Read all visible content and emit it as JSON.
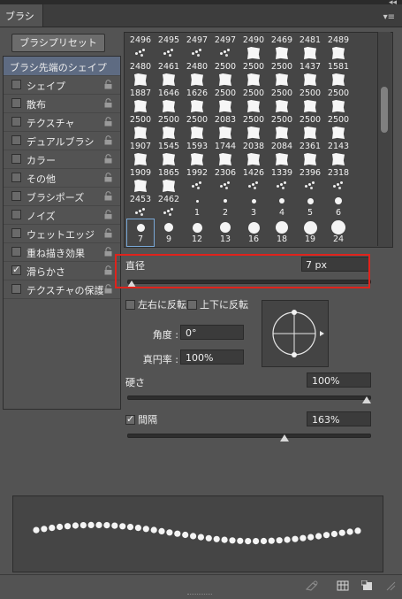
{
  "panel": {
    "tab": "ブラシ",
    "preset_button": "ブラシプリセット"
  },
  "options": [
    {
      "label": "ブラシ先端のシェイプ",
      "checkbox": false,
      "checked": false,
      "lock": false,
      "header": true
    },
    {
      "label": "シェイプ",
      "checkbox": true,
      "checked": false,
      "lock": true
    },
    {
      "label": "散布",
      "checkbox": true,
      "checked": false,
      "lock": true
    },
    {
      "label": "テクスチャ",
      "checkbox": true,
      "checked": false,
      "lock": true
    },
    {
      "label": "デュアルブラシ",
      "checkbox": true,
      "checked": false,
      "lock": true
    },
    {
      "label": "カラー",
      "checkbox": true,
      "checked": false,
      "lock": true
    },
    {
      "label": "その他",
      "checkbox": true,
      "checked": false,
      "lock": true
    },
    {
      "label": "ブラシポーズ",
      "checkbox": true,
      "checked": false,
      "lock": true
    },
    {
      "label": "ノイズ",
      "checkbox": true,
      "checked": false,
      "lock": true
    },
    {
      "label": "ウェットエッジ",
      "checkbox": true,
      "checked": false,
      "lock": true
    },
    {
      "label": "重ね描き効果",
      "checkbox": true,
      "checked": false,
      "lock": true
    },
    {
      "label": "滑らかさ",
      "checkbox": true,
      "checked": true,
      "lock": true
    },
    {
      "label": "テクスチャの保護",
      "checkbox": true,
      "checked": false,
      "lock": true
    }
  ],
  "brush_grid": {
    "rows": [
      [
        {
          "n": "2496",
          "k": "s"
        },
        {
          "n": "2495",
          "k": "s"
        },
        {
          "n": "2497",
          "k": "s"
        },
        {
          "n": "2497",
          "k": "s"
        },
        {
          "n": "2490",
          "k": "t"
        },
        {
          "n": "2469",
          "k": "t"
        },
        {
          "n": "2481",
          "k": "t"
        },
        {
          "n": "2489",
          "k": "t"
        }
      ],
      [
        {
          "n": "2480",
          "k": "t"
        },
        {
          "n": "2461",
          "k": "t"
        },
        {
          "n": "2480",
          "k": "t"
        },
        {
          "n": "2500",
          "k": "t"
        },
        {
          "n": "2500",
          "k": "t"
        },
        {
          "n": "2500",
          "k": "t"
        },
        {
          "n": "1437",
          "k": "t"
        },
        {
          "n": "1581",
          "k": "t"
        }
      ],
      [
        {
          "n": "1887",
          "k": "t"
        },
        {
          "n": "1646",
          "k": "t"
        },
        {
          "n": "1626",
          "k": "t"
        },
        {
          "n": "2500",
          "k": "t"
        },
        {
          "n": "2500",
          "k": "t"
        },
        {
          "n": "2500",
          "k": "t"
        },
        {
          "n": "2500",
          "k": "t"
        },
        {
          "n": "2500",
          "k": "t"
        }
      ],
      [
        {
          "n": "2500",
          "k": "t"
        },
        {
          "n": "2500",
          "k": "t"
        },
        {
          "n": "2500",
          "k": "t"
        },
        {
          "n": "2083",
          "k": "t"
        },
        {
          "n": "2500",
          "k": "t"
        },
        {
          "n": "2500",
          "k": "t"
        },
        {
          "n": "2500",
          "k": "t"
        },
        {
          "n": "2500",
          "k": "t"
        }
      ],
      [
        {
          "n": "1907",
          "k": "t"
        },
        {
          "n": "1545",
          "k": "t"
        },
        {
          "n": "1593",
          "k": "t"
        },
        {
          "n": "1744",
          "k": "t"
        },
        {
          "n": "2038",
          "k": "t"
        },
        {
          "n": "2084",
          "k": "t"
        },
        {
          "n": "2361",
          "k": "t"
        },
        {
          "n": "2143",
          "k": "t"
        }
      ],
      [
        {
          "n": "1909",
          "k": "t"
        },
        {
          "n": "1865",
          "k": "t"
        },
        {
          "n": "1992",
          "k": "s"
        },
        {
          "n": "2306",
          "k": "s"
        },
        {
          "n": "1426",
          "k": "s"
        },
        {
          "n": "1339",
          "k": "s"
        },
        {
          "n": "2396",
          "k": "s"
        },
        {
          "n": "2318",
          "k": "s"
        }
      ],
      [
        {
          "n": "2453",
          "k": "s"
        },
        {
          "n": "2462",
          "k": "s"
        },
        {
          "n": "1",
          "k": "d"
        },
        {
          "n": "2",
          "k": "d"
        },
        {
          "n": "3",
          "k": "d"
        },
        {
          "n": "4",
          "k": "d"
        },
        {
          "n": "5",
          "k": "d"
        },
        {
          "n": "6",
          "k": "d"
        }
      ],
      [
        {
          "n": "7",
          "k": "d"
        },
        {
          "n": "9",
          "k": "d"
        },
        {
          "n": "12",
          "k": "d"
        },
        {
          "n": "13",
          "k": "d"
        },
        {
          "n": "16",
          "k": "d"
        },
        {
          "n": "18",
          "k": "d"
        },
        {
          "n": "19",
          "k": "d"
        },
        {
          "n": "24",
          "k": "d"
        }
      ]
    ],
    "selected_row": 7,
    "selected_col": 0
  },
  "diameter": {
    "label": "直径",
    "value": "7 px",
    "slider_fraction": 0.0
  },
  "flip": {
    "x_label": "左右に反転",
    "y_label": "上下に反転"
  },
  "angle": {
    "label": "角度 :",
    "value": "0°"
  },
  "roundness": {
    "label": "真円率 :",
    "value": "100%"
  },
  "hardness": {
    "label": "硬さ",
    "value": "100%",
    "slider_fraction": 1.0
  },
  "spacing": {
    "label": "間隔",
    "value": "163%",
    "checked": true,
    "slider_fraction": 0.65
  },
  "colors": {
    "panel": "#535353",
    "selection_header": "#5e6b82",
    "highlight": "#e0231c"
  }
}
